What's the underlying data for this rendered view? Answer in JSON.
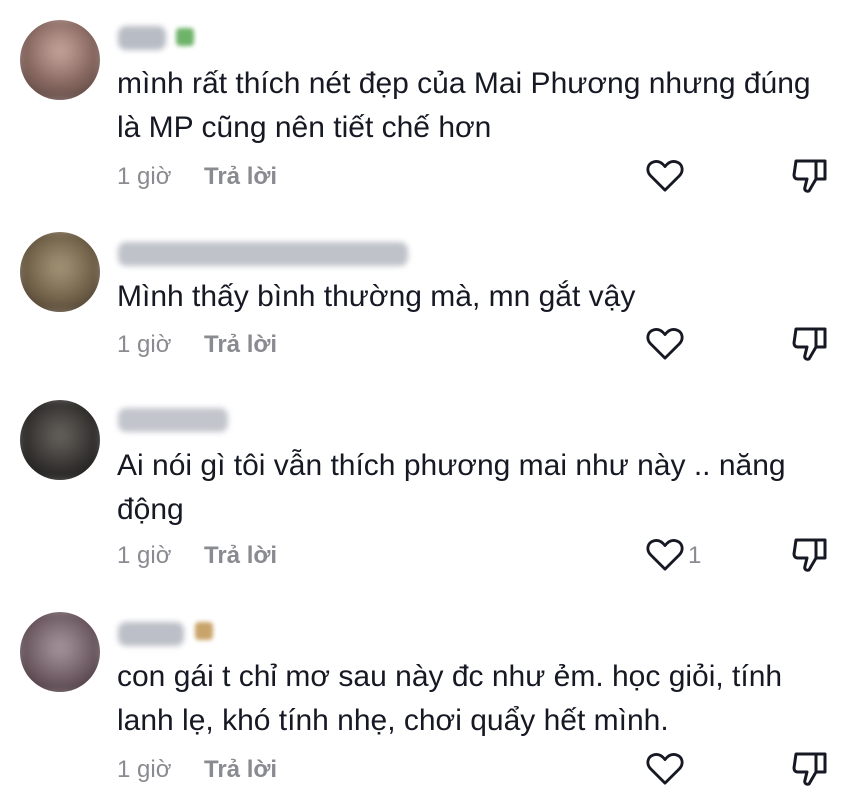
{
  "comments": [
    {
      "text": "mình rất thích nét đẹp của Mai Phương nhưng đúng là MP cũng nên tiết chế hơn",
      "time": "1 giờ",
      "reply_label": "Trả lời",
      "like_count": ""
    },
    {
      "text": "Mình thấy bình thường mà, mn gắt vậy",
      "time": "1 giờ",
      "reply_label": "Trả lời",
      "like_count": ""
    },
    {
      "text": "Ai nói gì tôi vẫn thích phương mai như này .. năng động",
      "time": "1 giờ",
      "reply_label": "Trả lời",
      "like_count": "1"
    },
    {
      "text": "con gái t chỉ mơ sau này đc như ẻm. học giỏi, tính lanh lẹ, khó tính nhẹ, chơi quẩy hết mình.",
      "time": "1 giờ",
      "reply_label": "Trả lời",
      "like_count": ""
    }
  ],
  "icons": {
    "like": "heart-outline-icon",
    "dislike": "thumbs-down-outline-icon"
  },
  "colors": {
    "text": "#161823",
    "meta": "#8a8b91",
    "icon": "#161823"
  }
}
